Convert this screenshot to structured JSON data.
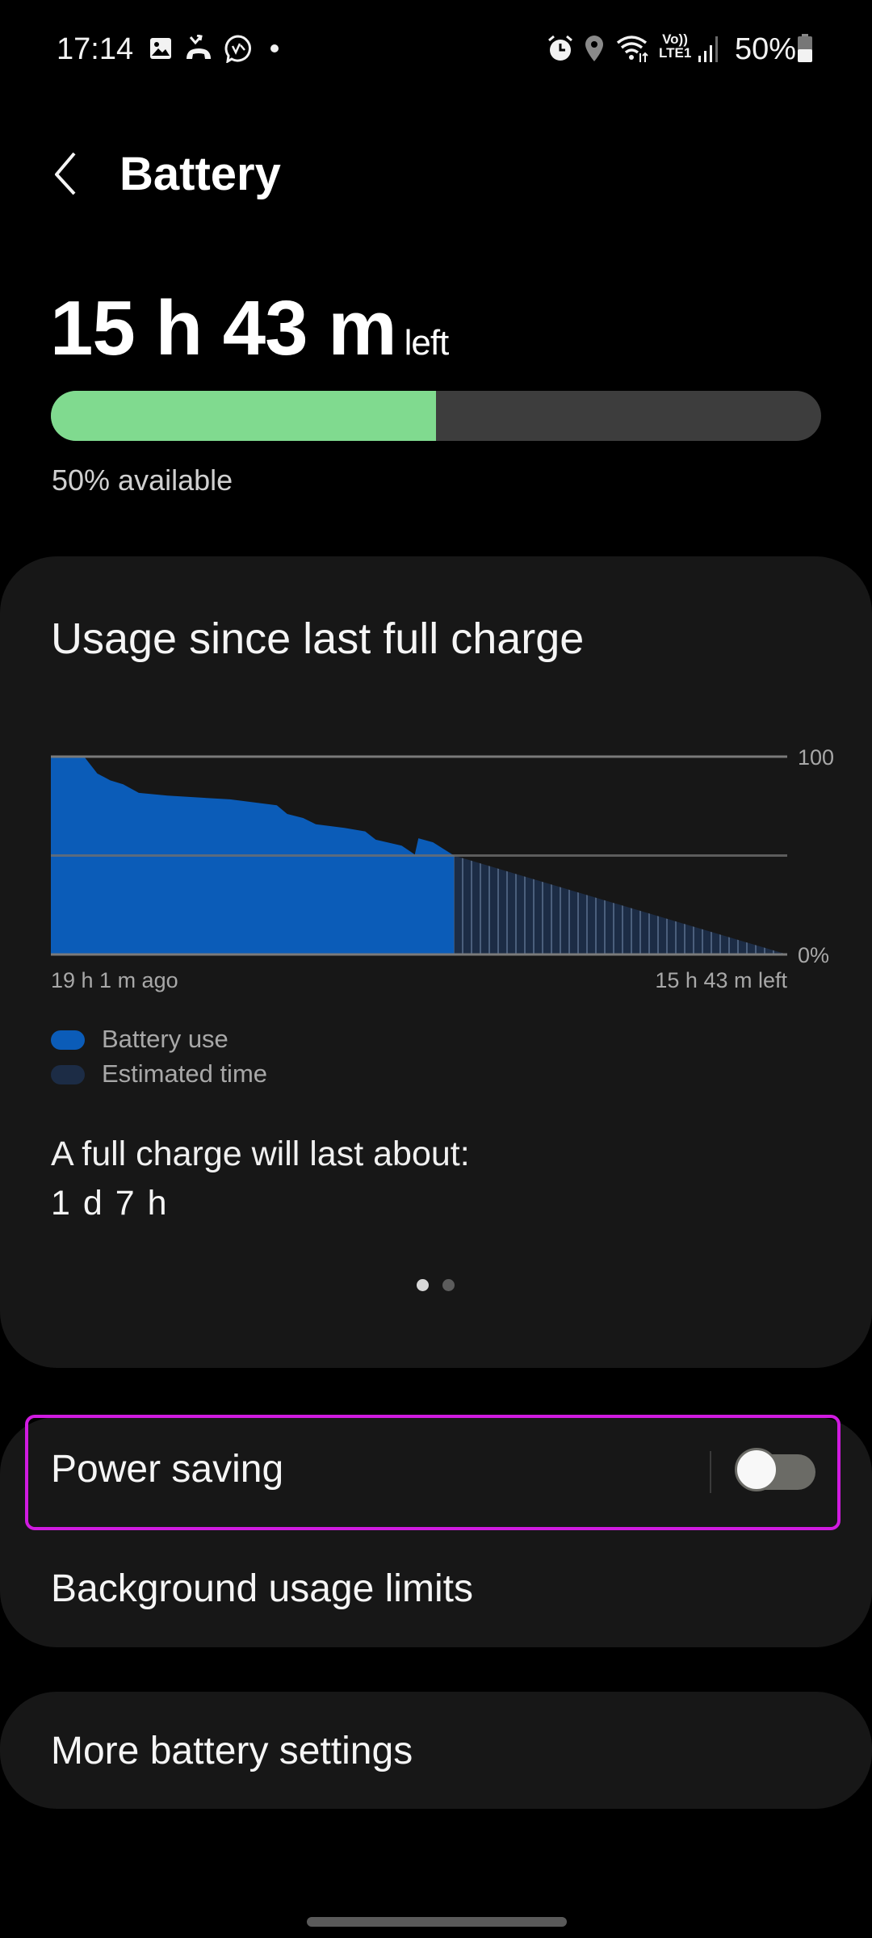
{
  "status_bar": {
    "time": "17:14",
    "left_icons": [
      "gallery-icon",
      "missed-call-icon",
      "messenger-icon",
      "dot-icon"
    ],
    "right_icons": [
      "alarm-icon",
      "location-icon",
      "wifi-icon",
      "volte-lte-icon",
      "signal-icon",
      "battery-icon"
    ],
    "volte_label": "Vo))",
    "lte_label": "LTE1",
    "battery_percent": "50%"
  },
  "header": {
    "title": "Battery",
    "back_icon": "chevron-left-icon"
  },
  "summary": {
    "time_left": "15 h 43 m",
    "time_left_suffix": "left",
    "battery_level_percent": 50,
    "available_text": "50% available",
    "bar_color": "#80DA8F"
  },
  "usage_card": {
    "title": "Usage since last full charge",
    "legend": [
      {
        "label": "Battery use",
        "color": "#0B5CB8"
      },
      {
        "label": "Estimated time",
        "color": "#1C2C45"
      }
    ],
    "full_charge_label": "A full charge will last about:",
    "full_charge_value": "1 d 7 h",
    "page_indicator": {
      "pages": 2,
      "current": 1
    }
  },
  "chart_data": {
    "type": "area",
    "x_unit": "hours relative to now",
    "xlim": [
      -19.02,
      15.72
    ],
    "ylim": [
      0,
      100
    ],
    "y_tick_labels": [
      "100",
      "0%"
    ],
    "y_ticks": [
      100,
      50,
      0
    ],
    "x_tick_labels": [
      "19 h 1 m ago",
      "15 h 43 m left"
    ],
    "grid": true,
    "series": [
      {
        "name": "Battery use",
        "color": "#0B5CB8",
        "style": "solid",
        "points": [
          [
            -19.02,
            100
          ],
          [
            -17.45,
            100
          ],
          [
            -16.83,
            91.5
          ],
          [
            -16.22,
            88
          ],
          [
            -15.61,
            86
          ],
          [
            -14.87,
            81.7
          ],
          [
            -13.52,
            80.3
          ],
          [
            -10.57,
            78.4
          ],
          [
            -8.36,
            75.4
          ],
          [
            -7.87,
            71
          ],
          [
            -7.12,
            69
          ],
          [
            -6.52,
            65.8
          ],
          [
            -5.17,
            64
          ],
          [
            -4.19,
            62.2
          ],
          [
            -3.69,
            58
          ],
          [
            -2.47,
            55
          ],
          [
            -1.85,
            50.5
          ],
          [
            -1.68,
            58.7
          ],
          [
            -0.99,
            56.7
          ],
          [
            0,
            50
          ]
        ]
      },
      {
        "name": "Estimated time",
        "color": "#1C2C45",
        "style": "striped",
        "points": [
          [
            0,
            50
          ],
          [
            15.72,
            0
          ]
        ]
      }
    ]
  },
  "settings": {
    "power_saving": {
      "label": "Power saving",
      "enabled": false
    },
    "background_limits": {
      "label": "Background usage limits"
    },
    "more_settings": {
      "label": "More battery settings"
    },
    "highlight_color": "#D01BE0"
  }
}
